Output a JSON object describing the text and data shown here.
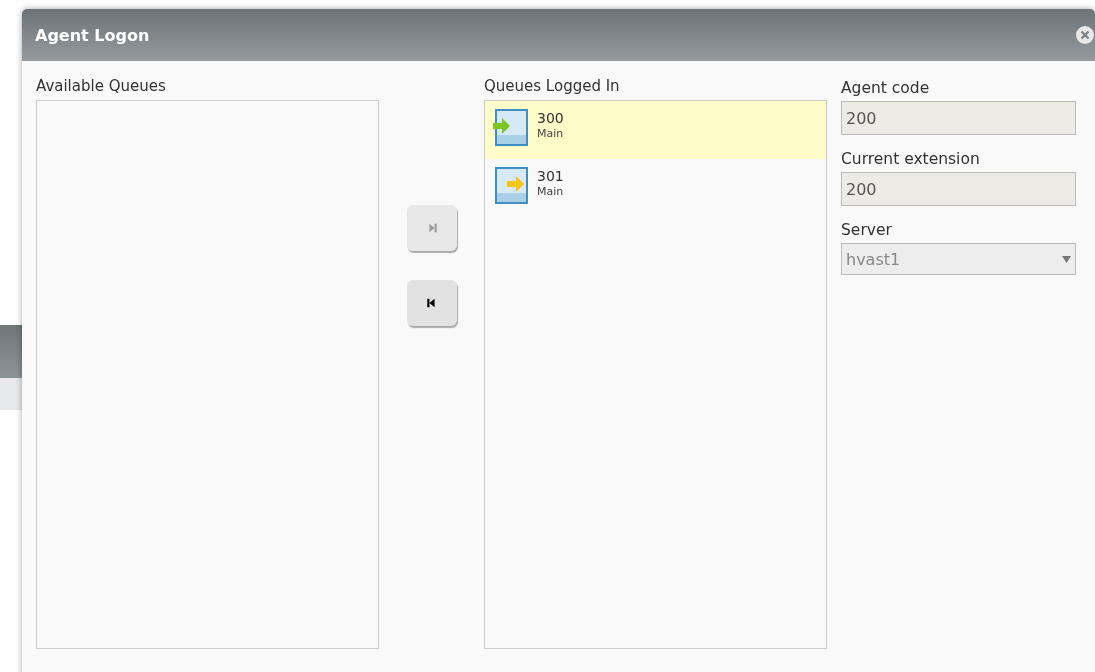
{
  "window": {
    "title": "Agent Logon"
  },
  "available_queues": {
    "label": "Available Queues"
  },
  "move_buttons": [
    {
      "kind": "add",
      "disabled": true
    },
    {
      "kind": "remove",
      "disabled": false
    }
  ],
  "logged_in_queues": {
    "label": "Queues Logged In",
    "items": [
      {
        "number": "300",
        "name": "Main",
        "selected": true,
        "color": "#7cc61e"
      },
      {
        "number": "301",
        "name": "Main",
        "selected": false,
        "color": "#f5c518"
      }
    ]
  },
  "fields": [
    {
      "kind": "input",
      "label": "Agent code",
      "value": "200"
    },
    {
      "kind": "input",
      "label": "Current extension",
      "value": "200"
    },
    {
      "kind": "select",
      "label": "Server",
      "value": "hvast1"
    }
  ]
}
